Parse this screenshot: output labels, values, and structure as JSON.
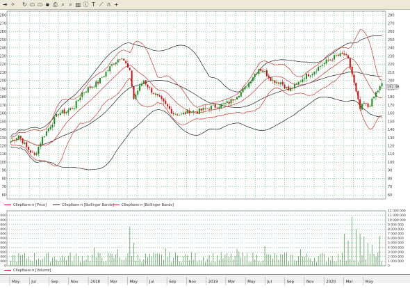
{
  "toolbar": {
    "icons": [
      "arrow-right-icon",
      "wand-icon",
      "refresh-icon",
      "window-icon",
      "window-icon",
      "save-icon",
      "print-icon",
      "zoom-icon",
      "zoom-icon",
      "chart-icon",
      "info-icon",
      "text-icon",
      "line-tool-icon",
      "magnet-icon",
      "crosshair-icon"
    ]
  },
  "colors": {
    "grid": "#22aa44",
    "up": "#1a8a1a",
    "down": "#cc1111",
    "bb_black": "#222222",
    "bb_red": "#cc3333",
    "volume": "#3c8f3c",
    "last_price_bg": "#e8e8e8"
  },
  "price_axis": {
    "labels": [
      "280",
      "270",
      "260",
      "250",
      "240",
      "230",
      "220",
      "210",
      "200",
      "190",
      "180",
      "170",
      "160",
      "150",
      "140",
      "130",
      "120",
      "110",
      "100",
      "90",
      "80",
      "70",
      "60"
    ],
    "last_price": "192.36"
  },
  "volume_axis": {
    "left_labels": [
      "11 000 000",
      "10 000 000",
      "9 000 000",
      "8 000 000",
      "7 000 000",
      "6 000 000",
      "5 000 000",
      "4 000 000",
      "3 000 000",
      "2 000 000",
      "1 000 000",
      "0"
    ],
    "right_labels": [
      "12 000 000",
      "11 000 000",
      "10 000 000",
      "9 000 000",
      "8 000 000",
      "7 000 000",
      "6 000 000",
      "5 000 000",
      "4 000 000",
      "3 000 000",
      "2 000 000",
      "1 000 000",
      "0"
    ]
  },
  "legend": {
    "price": "Сбербанк-п [Price]",
    "bb1": "Сбербанк-п [Bollinger Bands]",
    "bb2": "Сбербанк-п [Bollinger Bands]",
    "volume": "Сбербанк-п [Volume]"
  },
  "time_axis": {
    "labels": [
      "May",
      "Jul",
      "Sep",
      "Nov",
      "2018",
      "Mar",
      "May",
      "Jul",
      "Sep",
      "Nov",
      "2019",
      "Mar",
      "May",
      "Jul",
      "Sep",
      "Nov",
      "2020",
      "Mar",
      "May"
    ]
  },
  "chart_data": {
    "type": "candlestick",
    "x": [
      "May 2017",
      "Jul 2017",
      "Sep 2017",
      "Nov 2017",
      "Jan 2018",
      "Mar 2018",
      "May 2018",
      "Jul 2018",
      "Sep 2018",
      "Nov 2018",
      "Jan 2019",
      "Mar 2019",
      "May 2019",
      "Jul 2019",
      "Sep 2019",
      "Nov 2019",
      "Jan 2020",
      "Mar 2020",
      "May 2020"
    ],
    "ylim": [
      55,
      285
    ],
    "volume_ylim": [
      0,
      12000000
    ],
    "anchors": [
      [
        0,
        125
      ],
      [
        4,
        133
      ],
      [
        8,
        118
      ],
      [
        12,
        108
      ],
      [
        16,
        130
      ],
      [
        20,
        145
      ],
      [
        24,
        160
      ],
      [
        28,
        162
      ],
      [
        32,
        168
      ],
      [
        36,
        185
      ],
      [
        40,
        192
      ],
      [
        44,
        198
      ],
      [
        48,
        210
      ],
      [
        52,
        222
      ],
      [
        56,
        230
      ],
      [
        58,
        220
      ],
      [
        60,
        210
      ],
      [
        62,
        178
      ],
      [
        64,
        188
      ],
      [
        67,
        200
      ],
      [
        70,
        190
      ],
      [
        74,
        180
      ],
      [
        78,
        170
      ],
      [
        82,
        160
      ],
      [
        86,
        158
      ],
      [
        90,
        163
      ],
      [
        94,
        162
      ],
      [
        98,
        165
      ],
      [
        102,
        168
      ],
      [
        106,
        170
      ],
      [
        110,
        173
      ],
      [
        114,
        182
      ],
      [
        118,
        190
      ],
      [
        122,
        205
      ],
      [
        125,
        215
      ],
      [
        128,
        210
      ],
      [
        132,
        200
      ],
      [
        136,
        198
      ],
      [
        140,
        188
      ],
      [
        144,
        195
      ],
      [
        148,
        205
      ],
      [
        152,
        210
      ],
      [
        156,
        218
      ],
      [
        160,
        225
      ],
      [
        164,
        230
      ],
      [
        168,
        232
      ],
      [
        170,
        225
      ],
      [
        172,
        208
      ],
      [
        174,
        185
      ],
      [
        176,
        165
      ],
      [
        178,
        172
      ],
      [
        180,
        168
      ],
      [
        182,
        175
      ],
      [
        184,
        185
      ],
      [
        187,
        195
      ]
    ],
    "volume_spikes": [
      [
        42,
        4000000
      ],
      [
        54,
        3600000
      ],
      [
        60,
        8600000
      ],
      [
        62,
        5000000
      ],
      [
        78,
        3800000
      ],
      [
        114,
        3700000
      ],
      [
        128,
        4300000
      ],
      [
        146,
        3600000
      ],
      [
        168,
        7000000
      ],
      [
        170,
        5500000
      ],
      [
        172,
        10700000
      ],
      [
        174,
        8000000
      ],
      [
        176,
        7000000
      ],
      [
        178,
        6400000
      ],
      [
        180,
        5000000
      ],
      [
        182,
        4600000
      ],
      [
        186,
        6500000
      ]
    ]
  }
}
